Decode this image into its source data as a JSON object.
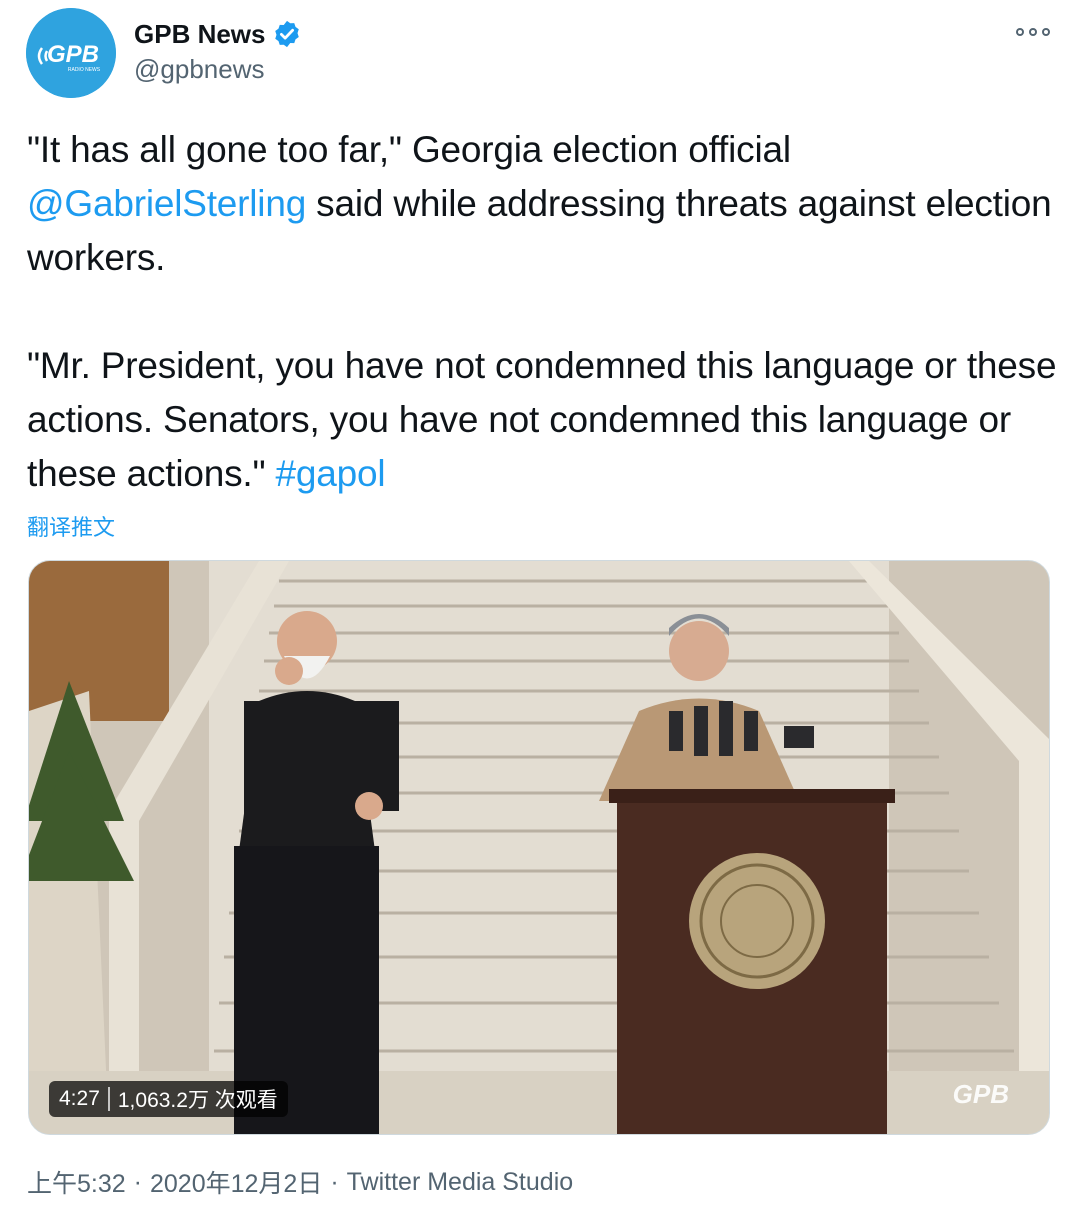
{
  "author": {
    "name": "GPB News",
    "handle": "@gpbnews",
    "avatar_text": "GPB",
    "avatar_subtext": "RADIO NEWS",
    "verified": true
  },
  "tweet": {
    "text_part1": "\"It has all gone too far,\" Georgia election official ",
    "mention": "@GabrielSterling",
    "text_part2": " said while addressing threats against election workers.\n\n\"Mr. President, you have not condemned this language or these actions. Senators, you have not condemned this language or these actions.\" ",
    "hashtag": "#gapol",
    "translate_label": "翻译推文"
  },
  "media": {
    "duration": "4:27",
    "views": "1,063.2万 次观看",
    "watermark": "GPB"
  },
  "meta": {
    "time": "上午5:32",
    "date": "2020年12月2日",
    "separator": "·",
    "source": "Twitter Media Studio"
  },
  "colors": {
    "accent": "#1d9bf0",
    "avatar_bg": "#2fa3df",
    "muted": "#536471"
  }
}
